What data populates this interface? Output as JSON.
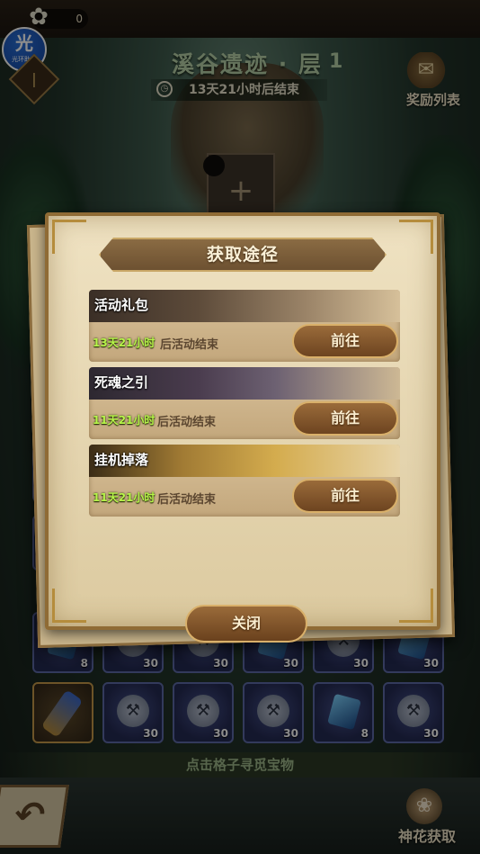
{
  "header": {
    "currency_value": "0",
    "helper_badge": {
      "big": "光",
      "small": "光环助手"
    },
    "stage_title": "溪谷遗迹 · 层",
    "stage_level": "1",
    "timer_text": "13天21小时后结束",
    "reward_list_label": "奖励列表"
  },
  "board": {
    "row1_counts": [
      "8",
      "30",
      "30",
      "30",
      "30",
      "30"
    ],
    "row2": [
      {
        "type": "torch",
        "count": ""
      },
      {
        "type": "hammer",
        "count": "30"
      },
      {
        "type": "hammer",
        "count": "30"
      },
      {
        "type": "hammer",
        "count": "30"
      },
      {
        "type": "gem",
        "count": "8"
      },
      {
        "type": "hammer",
        "count": "30"
      }
    ]
  },
  "hint_text": "点击格子寻觅宝物",
  "footer": {
    "flower_label": "神花获取"
  },
  "dialog": {
    "title": "获取途径",
    "sources": [
      {
        "name": "活动礼包",
        "time": "13天21小时",
        "suffix": "后活动结束",
        "button": "前往"
      },
      {
        "name": "死魂之引",
        "time": "11天21小时",
        "suffix": "后活动结束",
        "button": "前往"
      },
      {
        "name": "挂机掉落",
        "time": "11天21小时",
        "suffix": "后活动结束",
        "button": "前往"
      }
    ],
    "close_label": "关闭"
  },
  "icons": {
    "back": "back-arrow-icon",
    "clock": "clock-icon",
    "hammer": "hammer-icon",
    "flower": "flower-icon",
    "scroll": "scroll-icon"
  },
  "colors": {
    "accent_gold": "#d9b06a",
    "time_green": "#b7f54a",
    "dialog_bg": "#efe2c2",
    "button_brown": "#8a5e30"
  }
}
